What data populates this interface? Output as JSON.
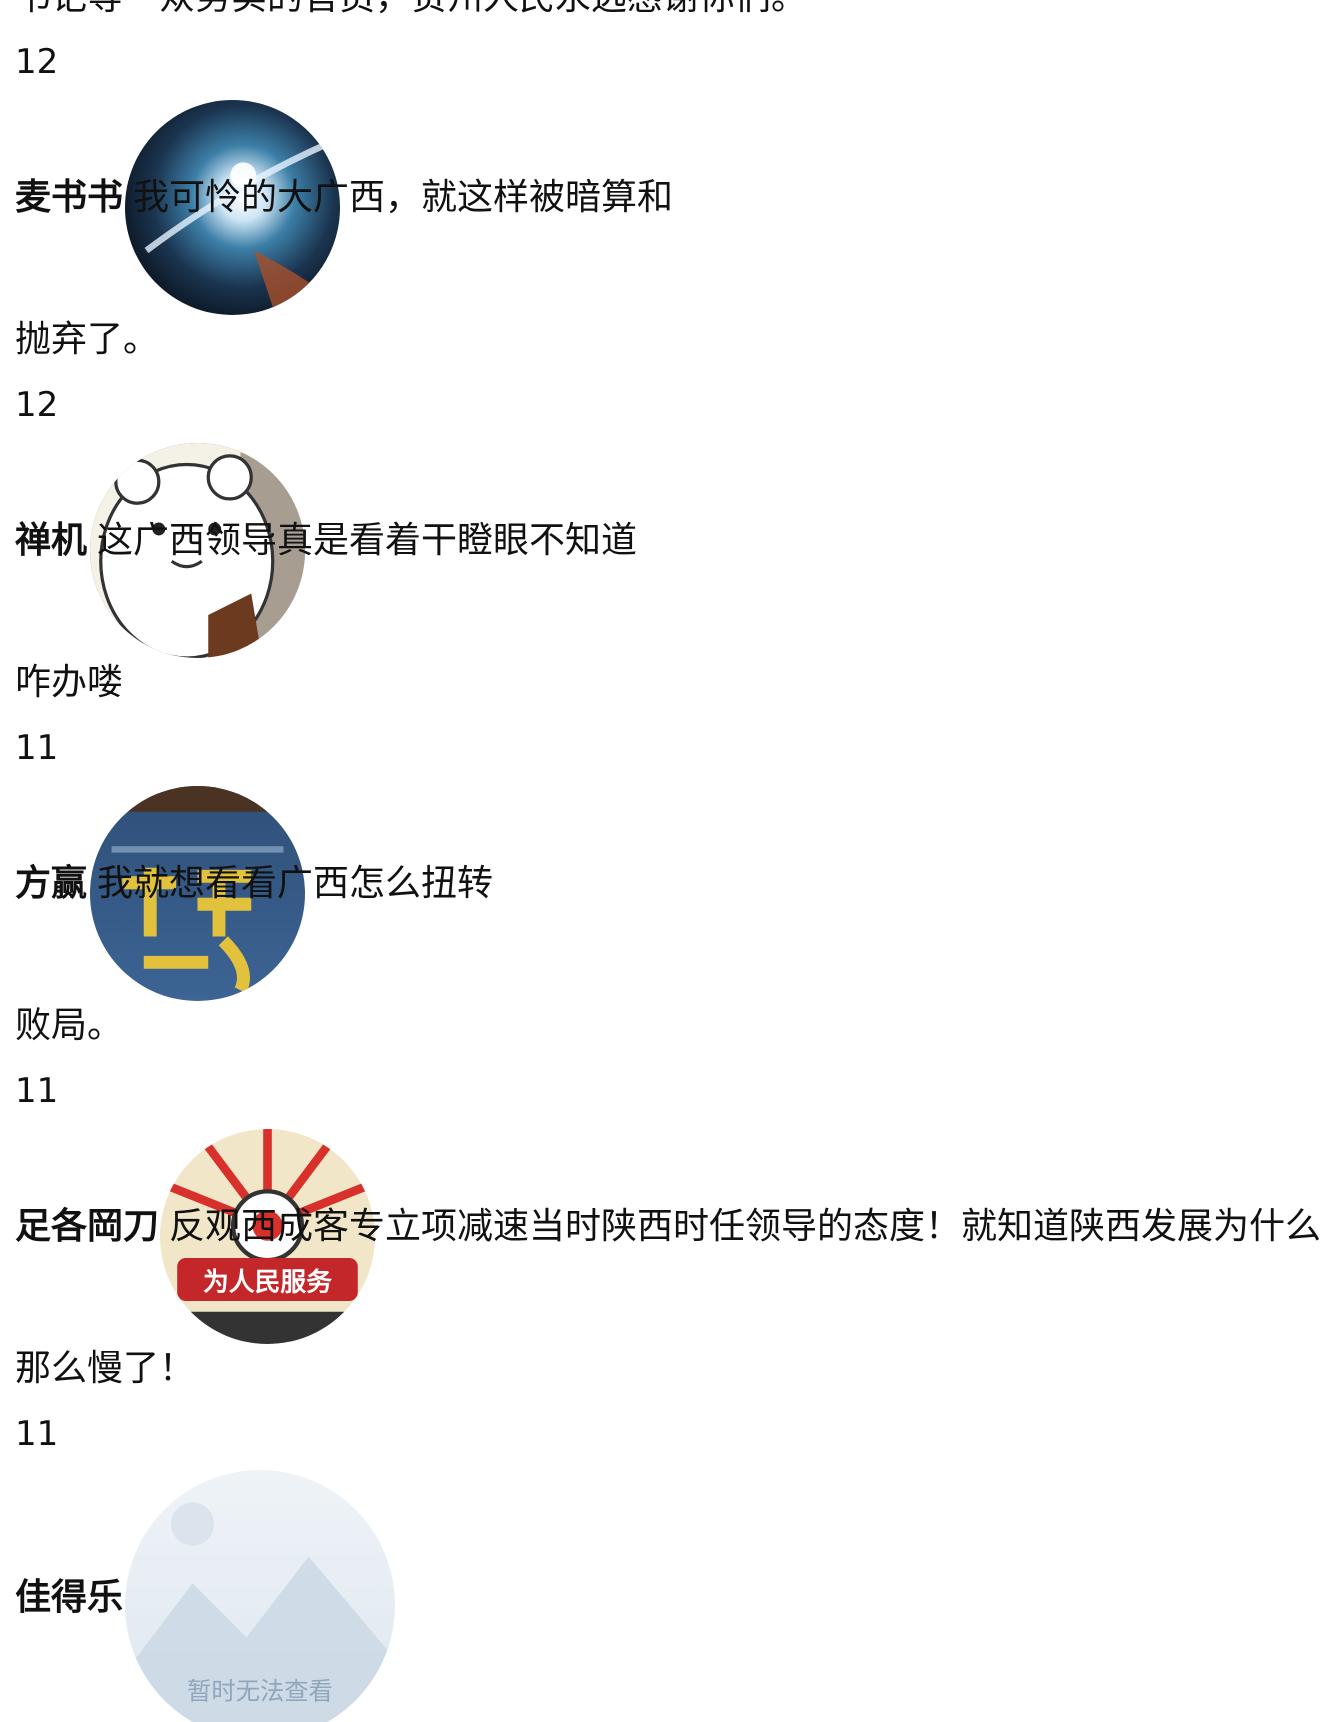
{
  "top_partial_text": "书记等一众务实的官员，贵州人民永远感谢你们。",
  "comments": [
    {
      "count": "12",
      "username": "麦书书",
      "text_line1": "我可怜的大广西，就这样被暗算和",
      "text_line2": "抛弃了。",
      "avatar_icon": "galaxy-avatar-icon"
    },
    {
      "count": "12",
      "username": "禅机",
      "text_line1": "这广西领导真是看着干瞪眼不知道",
      "text_line2": "咋办喽",
      "avatar_icon": "bear-avatar-icon"
    },
    {
      "count": "11",
      "username": "方赢",
      "text_line1": "我就想看看广西怎么扭转",
      "text_line2": "败局。",
      "avatar_icon": "poster-avatar-icon"
    },
    {
      "count": "11",
      "username": "足各岡刀",
      "text_line1": "反观西成客专立项减速当时陕西时任领导的态度！就知道陕西发展为什么",
      "text_line2": "那么慢了！",
      "avatar_icon": "serve-people-avatar-icon",
      "avatar_label": "为人民服务"
    },
    {
      "count": "11",
      "username": "佳得乐",
      "text_line1": "",
      "text_line2": "",
      "avatar_icon": "image-unavailable-icon",
      "avatar_label": "暂时无法查看"
    }
  ],
  "colors": {
    "text": "#111111",
    "background": "#ffffff",
    "placeholder_text": "#8fa6bd"
  }
}
